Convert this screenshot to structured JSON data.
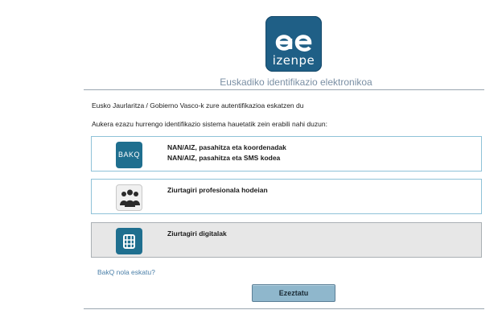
{
  "brand": {
    "logo_text": "izenpe",
    "logo_symbol": "ae"
  },
  "subtitle": "Euskadiko identifikazio elektronikoa",
  "intro_line": "Eusko Jaurlaritza / Gobierno Vasco-k zure autentifikazioa eskatzen du",
  "choose_line": "Aukera ezazu hurrengo identifikazio sistema hauetatik zein erabili nahi duzun:",
  "options": [
    {
      "icon": "bakq-icon",
      "icon_text": "BAKQ",
      "lines": [
        "NAN/AIZ, pasahitza eta koordenadak",
        "NAN/AIZ, pasahitza eta SMS kodea"
      ]
    },
    {
      "icon": "professionals-group-icon",
      "lines": [
        "Ziurtagiri profesionala hodeian"
      ]
    },
    {
      "icon": "chip-card-icon",
      "lines": [
        "Ziurtagiri digitalak"
      ],
      "selected": true
    }
  ],
  "bakq_link": "BakQ nola eskatu?",
  "confirm_button": "Ezeztatu",
  "colors": {
    "brand_blue": "#1f5f86",
    "option_border": "#8fc2d8",
    "button_bg": "#8fb7cc",
    "link": "#4a7fa8"
  }
}
